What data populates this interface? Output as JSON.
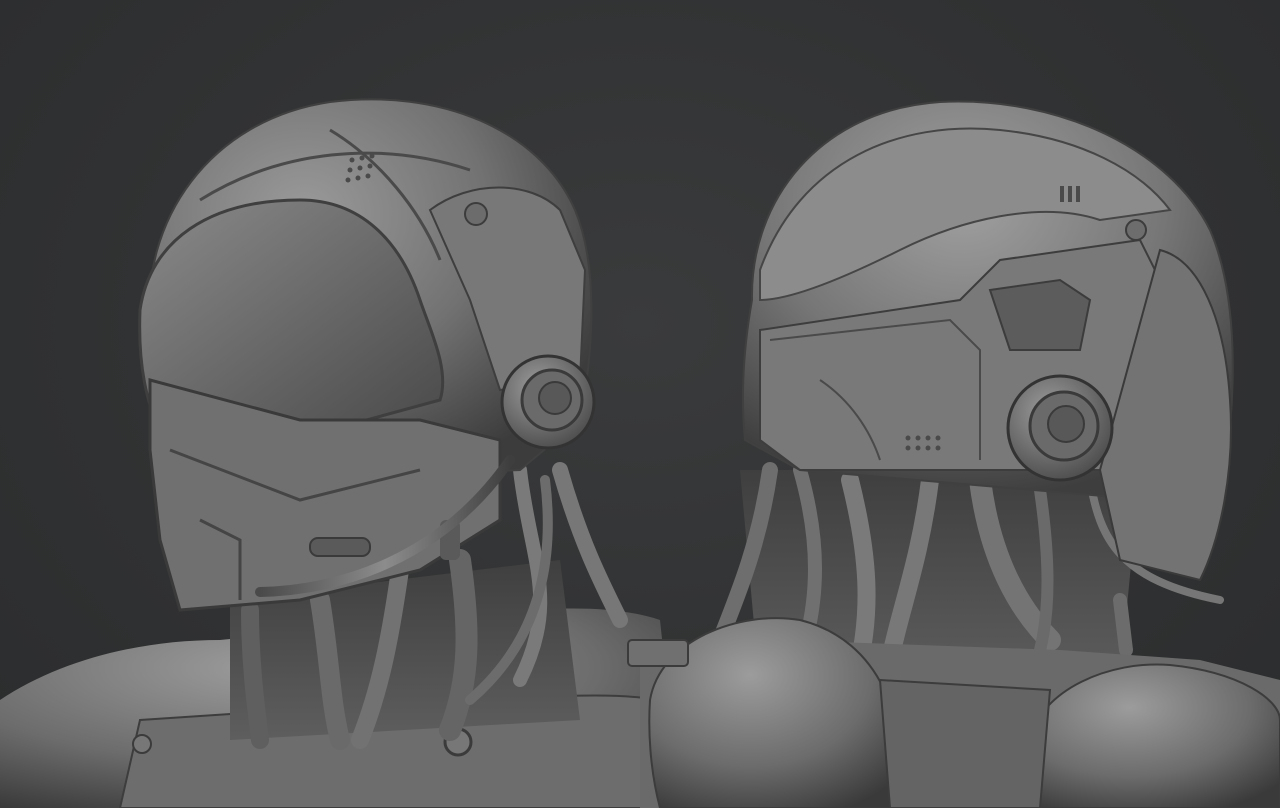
{
  "scene": {
    "background_color": "#323334",
    "subjects": [
      {
        "name": "robot-head-three-quarter-front",
        "orientation": "facing-left"
      },
      {
        "name": "robot-head-three-quarter-back",
        "orientation": "facing-right"
      }
    ],
    "material_color": "#7d7d7d"
  }
}
